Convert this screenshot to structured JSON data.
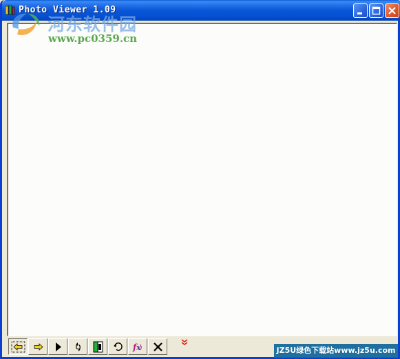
{
  "window": {
    "title": "Photo Viewer 1.09"
  },
  "watermark": {
    "site_name_cn": "河东软件园",
    "url": "www.pc0359.cn"
  },
  "footer_badge": {
    "text": "JZ5U绿色下载站www.jz5u.com"
  },
  "titlebar_buttons": [
    "minimize-icon",
    "maximize-icon",
    "close-icon"
  ],
  "toolbar_buttons": [
    "back-arrow-icon",
    "forward-arrow-icon",
    "play-icon",
    "refresh-icon",
    "fit-window-icon",
    "rotate-icon",
    "fx-effects-icon",
    "delete-icon",
    "more-chevron-icon"
  ],
  "colors": {
    "titlebar": "#0a57d6",
    "face": "#ece9d8",
    "close_button": "#e05a2e",
    "watermark_green": "#59a94f",
    "badge_bg": "#1f6f9f"
  }
}
